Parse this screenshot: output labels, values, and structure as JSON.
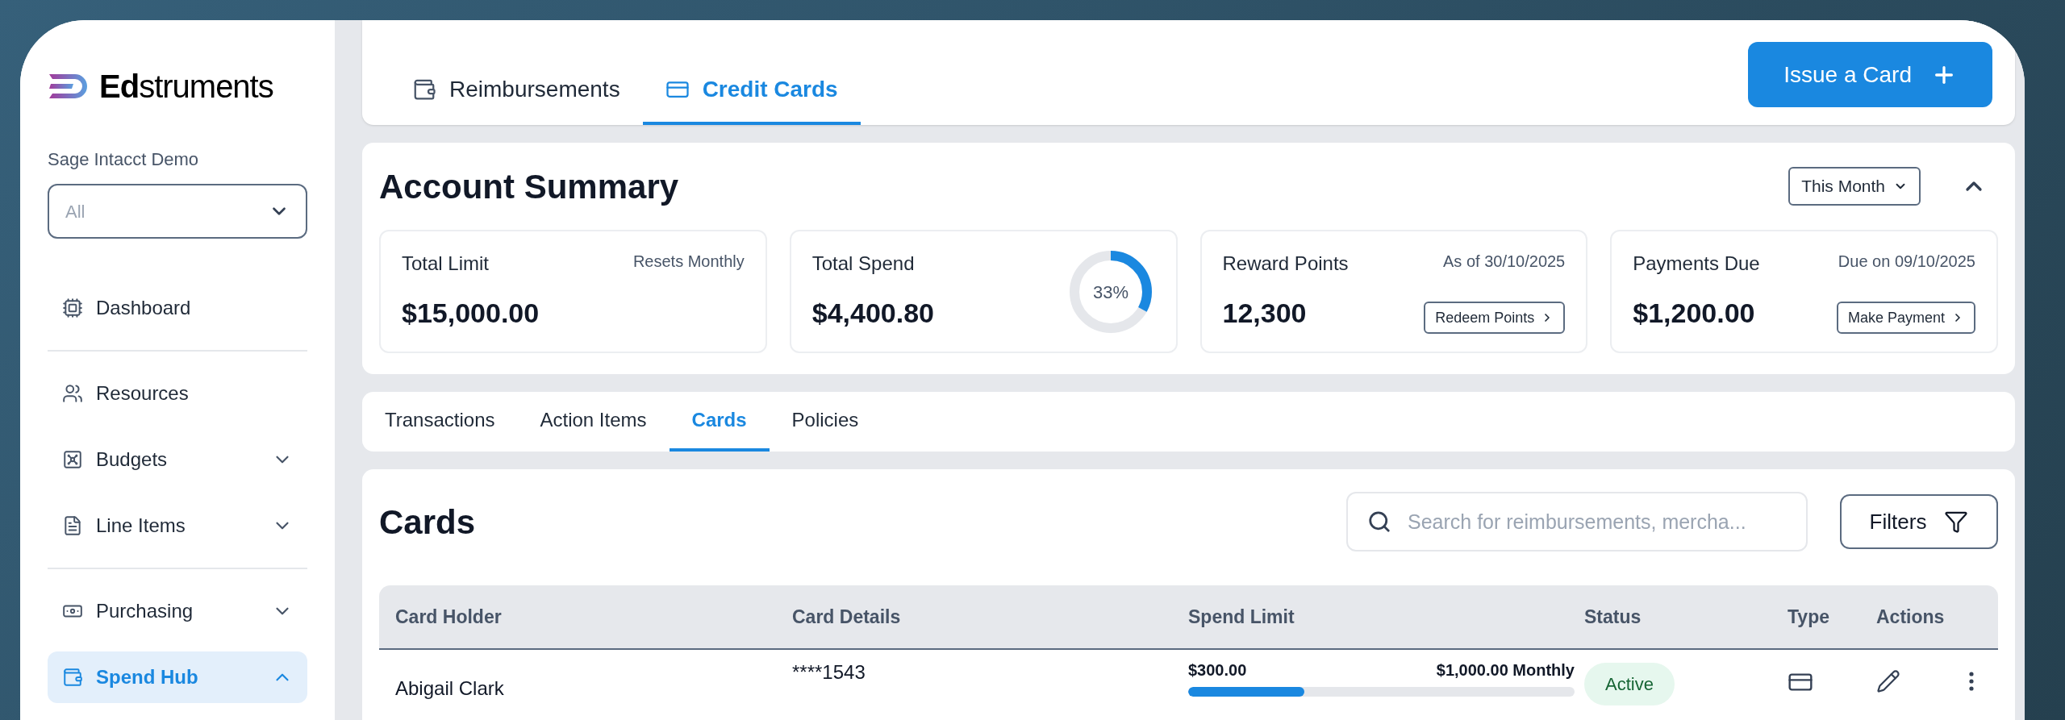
{
  "logo": {
    "bold": "Ed",
    "rest": "struments"
  },
  "sidebar": {
    "org_label": "Sage Intacct Demo",
    "org_select": {
      "placeholder": "All"
    },
    "groups": [
      [
        {
          "label": "Dashboard",
          "selected": false
        }
      ],
      [
        {
          "label": "Resources",
          "selected": false
        },
        {
          "label": "Budgets",
          "selected": false,
          "expanded": false
        },
        {
          "label": "Line Items",
          "selected": false,
          "expanded": false
        }
      ],
      [
        {
          "label": "Purchasing",
          "selected": false,
          "expanded": false
        },
        {
          "label": "Spend Hub",
          "selected": true,
          "expanded": true
        }
      ]
    ]
  },
  "top_tabs": [
    {
      "label": "Reimbursements",
      "selected": false
    },
    {
      "label": "Credit Cards",
      "selected": true
    }
  ],
  "issue_button": {
    "label": "Issue a Card"
  },
  "summary": {
    "title": "Account Summary",
    "period_select": "This Month",
    "expanded": true,
    "metrics": [
      {
        "kind": "plain",
        "title": "Total Limit",
        "note": "Resets Monthly",
        "value": "$15,000.00"
      },
      {
        "kind": "donut",
        "title": "Total Spend",
        "value": "$4,400.80",
        "level": 0.33,
        "reading": "33%"
      },
      {
        "kind": "action",
        "title": "Reward Points",
        "note": "As of 30/10/2025",
        "value": "12,300",
        "action": "Redeem Points"
      },
      {
        "kind": "action",
        "title": "Payments Due",
        "note": "Due on 09/10/2025",
        "value": "$1,200.00",
        "action": "Make Payment"
      }
    ]
  },
  "sub_tabs": [
    {
      "label": "Transactions",
      "selected": false
    },
    {
      "label": "Action Items",
      "selected": false
    },
    {
      "label": "Cards",
      "selected": true
    },
    {
      "label": "Policies",
      "selected": false
    }
  ],
  "cards": {
    "title": "Cards",
    "search": {
      "placeholder": "Search for reimbursements, mercha..."
    },
    "filters_button": "Filters",
    "table": {
      "columns": [
        "Card Holder",
        "Card Details",
        "Spend Limit",
        "Status",
        "Type",
        "Actions"
      ],
      "rows": [
        {
          "holder": "Abigail Clark",
          "card_details": "****1543",
          "spent": "$300.00",
          "limit": "$1,000.00 Monthly",
          "level": 0.3,
          "status": "Active"
        }
      ]
    }
  }
}
